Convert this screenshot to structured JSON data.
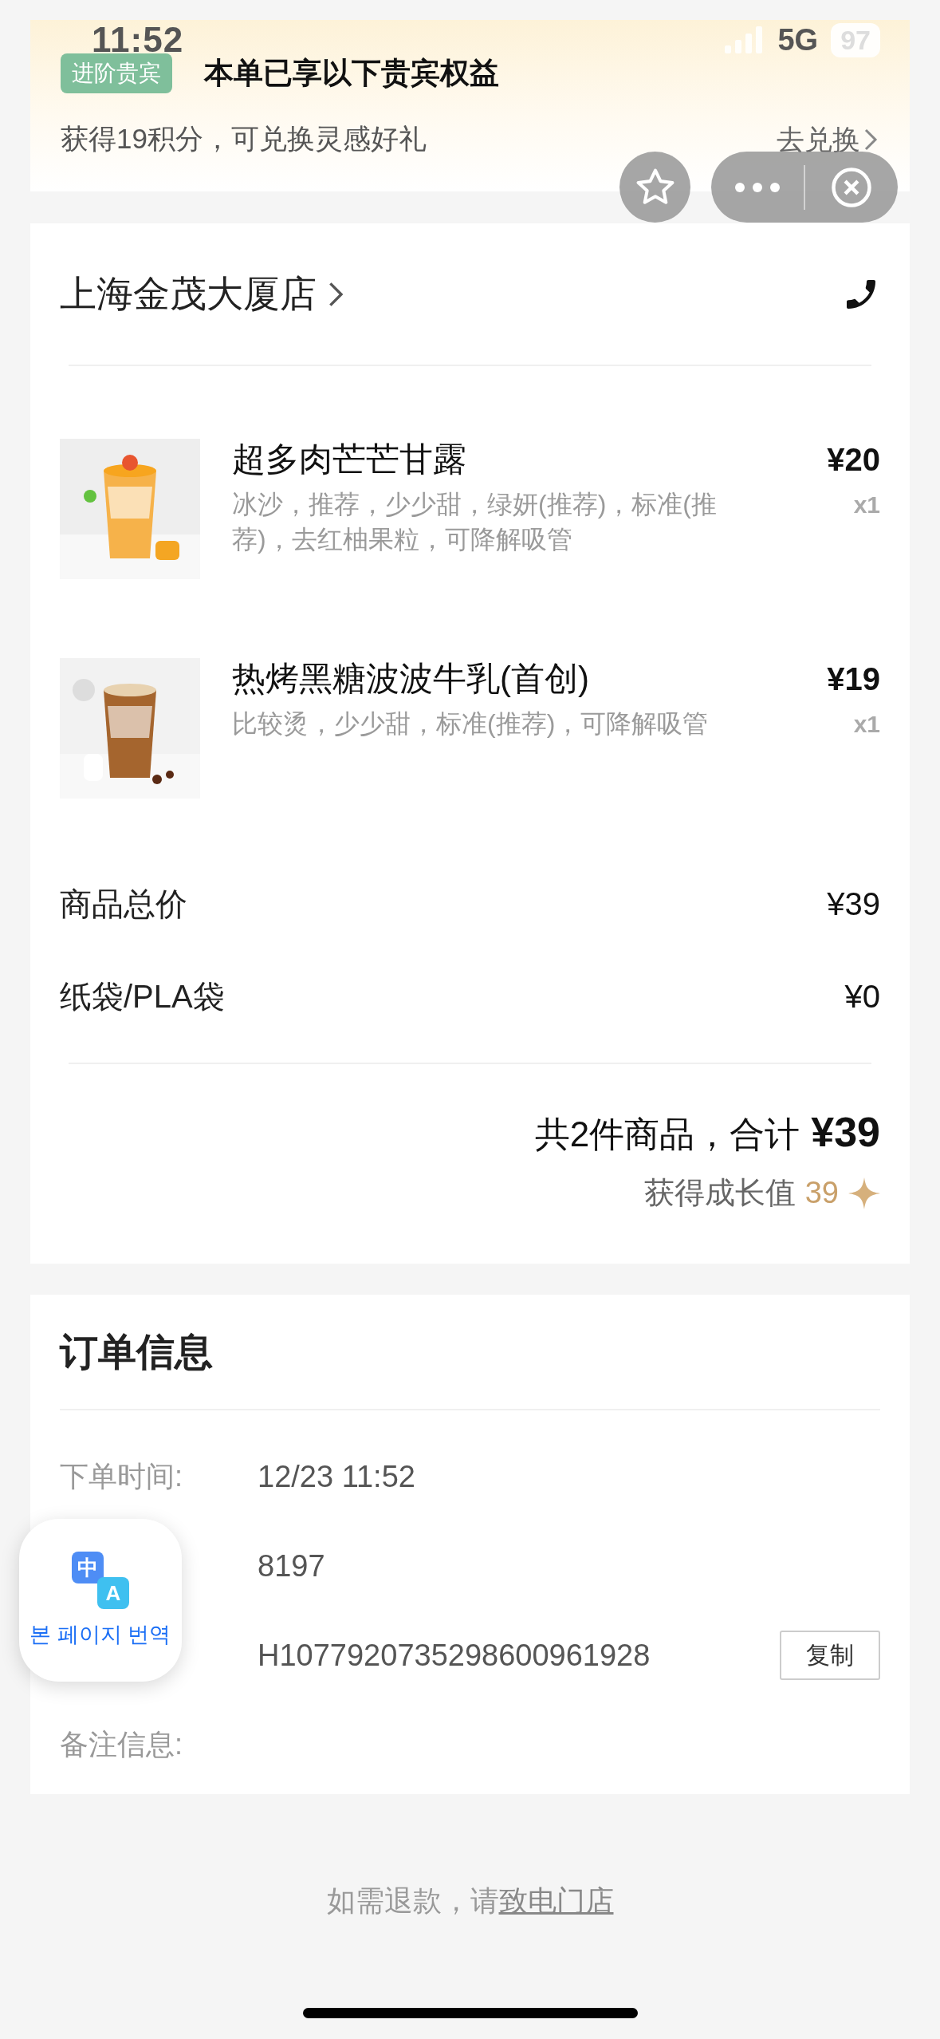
{
  "status_bar": {
    "time": "11:52",
    "network": "5G",
    "battery": "97"
  },
  "banner": {
    "badge": "进阶贵宾",
    "title": "本单已享以下贵宾权益",
    "subtitle": "获得19积分，可兑换灵感好礼",
    "action": "去兑换"
  },
  "store": {
    "name": "上海金茂大厦店"
  },
  "items": [
    {
      "name": "超多肉芒芒甘露",
      "options": "冰沙，推荐，少少甜，绿妍(推荐)，标准(推荐)，去红柚果粒，可降解吸管",
      "price": "¥20",
      "quantity": "x1"
    },
    {
      "name": "热烤黑糖波波牛乳(首创)",
      "options": "比较烫，少少甜，标准(推荐)，可降解吸管",
      "price": "¥19",
      "quantity": "x1"
    }
  ],
  "summary": [
    {
      "label": "商品总价",
      "value": "¥39"
    },
    {
      "label": "纸袋/PLA袋",
      "value": "¥0"
    }
  ],
  "total": {
    "label": "共2件商品，合计",
    "amount": "¥39",
    "growth_label": "获得成长值",
    "growth_value": "39"
  },
  "order_info": {
    "title": "订单信息",
    "rows": [
      {
        "label": "下单时间:",
        "value": "12/23 11:52"
      },
      {
        "value": "8197"
      },
      {
        "value": "H1077920735298600961928",
        "action": "复制"
      },
      {
        "label": "备注信息:"
      }
    ]
  },
  "translate_button": {
    "glyphs": [
      "中",
      "A"
    ],
    "label": "본 페이지 번역"
  },
  "footer": {
    "text": "如需退款，请",
    "link": "致电门店"
  }
}
